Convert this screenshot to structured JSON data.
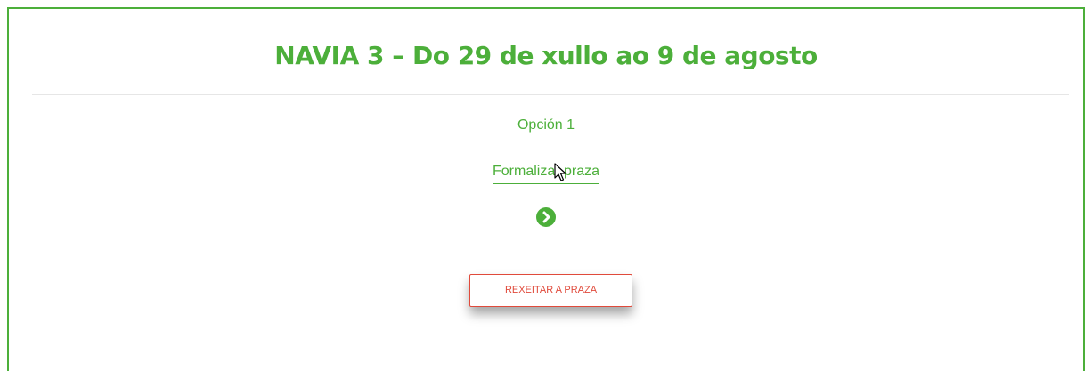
{
  "header": {
    "title": "NAVIA 3 – Do 29 de xullo ao 9 de agosto"
  },
  "option": {
    "label": "Opción 1",
    "link_text": "Formalizar praza",
    "next_icon": "chevron-right-circle-icon"
  },
  "actions": {
    "reject_label": "REXEITAR A PRAZA"
  },
  "colors": {
    "accent": "#4caf3a",
    "danger": "#e04a3b",
    "divider": "#e6e6e6"
  }
}
